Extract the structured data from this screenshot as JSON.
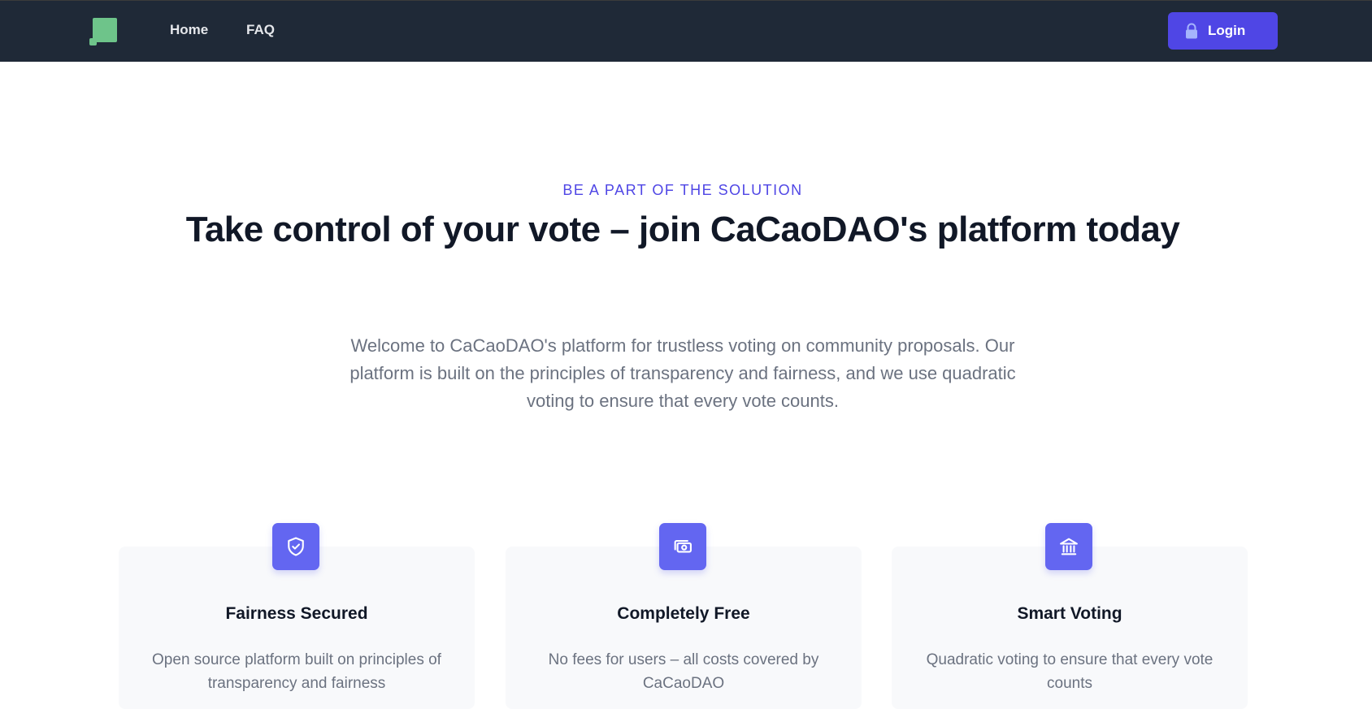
{
  "nav": {
    "logo_icon": "green-blocks-logo",
    "links": [
      {
        "label": "Home"
      },
      {
        "label": "FAQ"
      }
    ],
    "login": {
      "label": "Login",
      "icon": "lock-icon"
    }
  },
  "hero": {
    "eyebrow": "BE A PART OF THE SOLUTION",
    "headline": "Take control of your vote – join CaCaoDAO's platform today",
    "intro": "Welcome to CaCaoDAO's platform for trustless voting on community proposals. Our platform is built on the principles of transparency and fairness, and we use quadratic voting to ensure that every vote counts."
  },
  "features": [
    {
      "icon": "shield-check-icon",
      "title": "Fairness Secured",
      "description": "Open source platform built on principles of transparency and fairness"
    },
    {
      "icon": "cash-icon",
      "title": "Completely Free",
      "description": "No fees for users – all costs covered by CaCaoDAO"
    },
    {
      "icon": "bank-icon",
      "title": "Smart Voting",
      "description": "Quadratic voting to ensure that every vote counts"
    }
  ],
  "colors": {
    "navbar_bg": "#1f2937",
    "accent": "#4f46e5",
    "icon_bg": "#6366f1",
    "logo": "#6ec48a"
  }
}
